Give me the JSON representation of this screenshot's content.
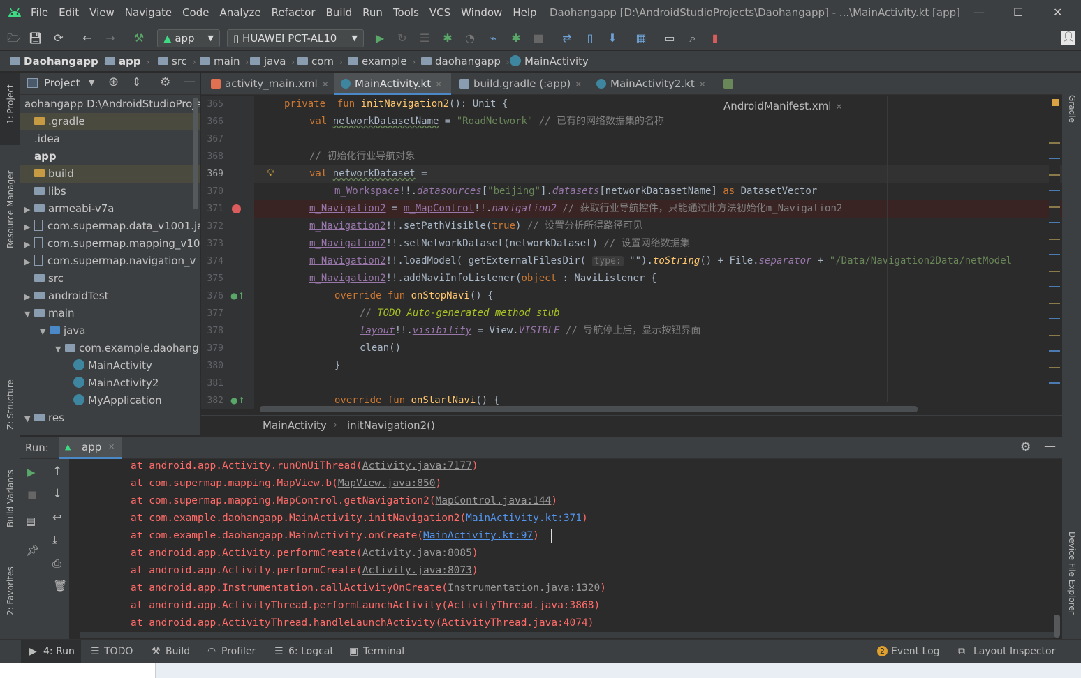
{
  "menu": [
    "File",
    "Edit",
    "View",
    "Navigate",
    "Code",
    "Analyze",
    "Refactor",
    "Build",
    "Run",
    "Tools",
    "VCS",
    "Window",
    "Help"
  ],
  "window_title": "Daohangapp [D:\\AndroidStudioProjects\\Daohangapp] - ...\\MainActivity.kt [app]",
  "toolbar": {
    "config": "app",
    "device": "HUAWEI PCT-AL10"
  },
  "breadcrumbs": [
    "Daohangapp",
    "app",
    "src",
    "main",
    "java",
    "com",
    "example",
    "daohangapp",
    "MainActivity"
  ],
  "left_strip": {
    "project": "1: Project",
    "resource_manager": "Resource Manager",
    "structure": "Z: Structure",
    "build_variants": "Build Variants",
    "favorites": "2: Favorites"
  },
  "right_strip": {
    "gradle": "Gradle",
    "device_explorer": "Device File Explorer"
  },
  "project_panel": {
    "title": "Project",
    "tree": [
      "aohangapp  D:\\AndroidStudioProje",
      ".gradle",
      ".idea",
      "app",
      "build",
      "libs",
      "armeabi-v7a",
      "com.supermap.data_v1001.ja",
      "com.supermap.mapping_v10",
      "com.supermap.navigation_v",
      "src",
      "androidTest",
      "main",
      "java",
      "com.example.daohang",
      "MainActivity",
      "MainActivity2",
      "MyApplication",
      "res"
    ]
  },
  "editor_tabs": [
    "activity_main.xml",
    "MainActivity.kt",
    "build.gradle (:app)",
    "MainActivity2.kt",
    "AndroidManifest.xml"
  ],
  "line_numbers": [
    "365",
    "366",
    "367",
    "368",
    "369",
    "370",
    "371",
    "372",
    "373",
    "374",
    "375",
    "376",
    "377",
    "378",
    "379",
    "380",
    "381",
    "382"
  ],
  "code_text": {
    "l365a": "private  fun ",
    "l365b": "initNavigation2",
    "l365c": "(): Unit {",
    "l366a": "val ",
    "l366b": "networkDatasetName",
    "l366c": " = ",
    "l366d": "\"RoadNetwork\"",
    "l366e": " // 已有的网络数据集的名称",
    "l368": "// 初始化行业导航对象",
    "l369a": "val ",
    "l369b": "networkDataset",
    "l369c": " =",
    "l370a": "m_Workspace",
    "l370b": "!!.",
    "l370c": "datasources",
    "l370d": "[",
    "l370e": "\"beijing\"",
    "l370f": "].",
    "l370g": "datasets",
    "l370h": "[networkDatasetName] ",
    "l370i": "as",
    "l370j": " DatasetVector",
    "l371a": "m_Navigation2",
    "l371b": " = ",
    "l371c": "m_MapControl",
    "l371d": "!!.",
    "l371e": "navigation2",
    "l371f": " // 获取行业导航控件，只能通过此方法初始化m_Navigation2",
    "l372a": "m_Navigation2",
    "l372b": "!!.setPathVisible(",
    "l372c": "true",
    "l372d": ") ",
    "l372e": "// 设置分析所得路径可见",
    "l373a": "m_Navigation2",
    "l373b": "!!.setNetworkDataset(networkDataset) ",
    "l373c": "// 设置网络数据集",
    "l374a": "m_Navigation2",
    "l374b": "!!.loadModel( getExternalFilesDir( ",
    "l374c": "type:",
    "l374d": " \"\").",
    "l374e": "toString",
    "l374f": "() + File.",
    "l374g": "separator",
    "l374h": " + ",
    "l374i": "\"/Data/Navigation2Data/netModel",
    "l375a": "m_Navigation2",
    "l375b": "!!.addNaviInfoListener(",
    "l375c": "object",
    "l375d": " : NaviListener {",
    "l376a": "override fun ",
    "l376b": "onStopNavi",
    "l376c": "() {",
    "l377a": "// ",
    "l377b": "TODO Auto-generated method stub",
    "l378a": "layout",
    "l378b": "!!.",
    "l378c": "visibility",
    "l378d": " = View.",
    "l378e": "VISIBLE",
    "l378f": " // 导航停止后，显示按钮界面",
    "l379": "clean()",
    "l380": "}",
    "l382a": "override fun ",
    "l382b": "onStartNavi",
    "l382c": "() {"
  },
  "editor_breadcrumb": [
    "MainActivity",
    "initNavigation2()"
  ],
  "run_panel": {
    "label": "Run:",
    "tab": "app",
    "lines": [
      {
        "pre": "at android.app.Activity.runOnUiThread(",
        "link": "Activity.java:7177",
        "post": ")",
        "kind": "gray"
      },
      {
        "pre": "at com.supermap.mapping.MapView.b(",
        "link": "MapView.java:850",
        "post": ")",
        "kind": "gray"
      },
      {
        "pre": "at com.supermap.mapping.MapControl.getNavigation2(",
        "link": "MapControl.java:144",
        "post": ")",
        "kind": "gray"
      },
      {
        "pre": "at com.example.daohangapp.MainActivity.initNavigation2(",
        "link": "MainActivity.kt:371",
        "post": ")",
        "kind": "blue"
      },
      {
        "pre": "at com.example.daohangapp.MainActivity.onCreate(",
        "link": "MainActivity.kt:97",
        "post": ")",
        "kind": "blue"
      },
      {
        "pre": "at android.app.Activity.performCreate(",
        "link": "Activity.java:8085",
        "post": ")",
        "kind": "gray"
      },
      {
        "pre": "at android.app.Activity.performCreate(",
        "link": "Activity.java:8073",
        "post": ")",
        "kind": "gray"
      },
      {
        "pre": "at android.app.Instrumentation.callActivityOnCreate(",
        "link": "Instrumentation.java:1320",
        "post": ")",
        "kind": "gray"
      },
      {
        "pre": "at android.app.ActivityThread.performLaunchActivity(ActivityThread.java:3868)",
        "link": "",
        "post": "",
        "kind": "none"
      },
      {
        "pre": "at android.app.ActivityThread.handleLaunchActivity(ActivityThread.java:4074)",
        "link": "",
        "post": "",
        "kind": "none"
      }
    ]
  },
  "status_tabs": [
    "4: Run",
    "TODO",
    "Build",
    "Profiler",
    "6: Logcat",
    "Terminal"
  ],
  "status_right": {
    "event_count": "2",
    "event_log": "Event Log",
    "layout_inspector": "Layout Inspector"
  },
  "colors": {
    "accent": "#4a88c7",
    "error": "#ff6b68",
    "breakpoint": "#db5c5c",
    "run_green": "#59a869"
  }
}
